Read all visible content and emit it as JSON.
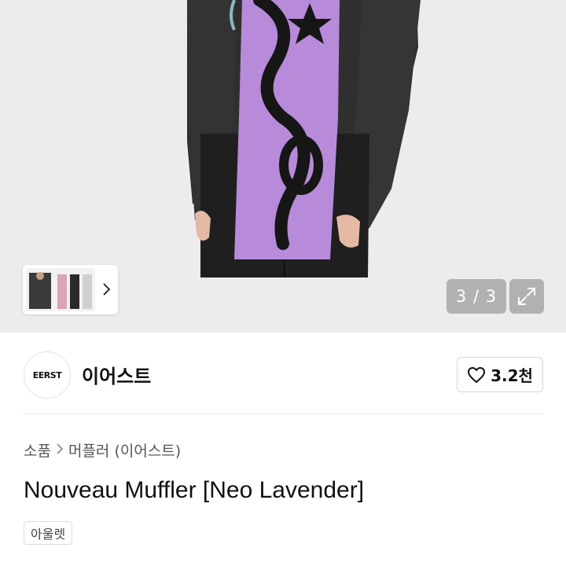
{
  "gallery": {
    "counter": "3 / 3",
    "image_count": 3,
    "current_index": 3,
    "product_colors": {
      "scarf": "#b78bd9",
      "scarf_pattern": "#161616",
      "sweater": "#2e2e2e",
      "background": "#ececec"
    }
  },
  "seller": {
    "logo_text": "EERST",
    "name": "이어스트",
    "like_count": "3.2천"
  },
  "breadcrumb": {
    "category": "소품",
    "subcategory": "머플러 (이어스트)"
  },
  "product": {
    "title": "Nouveau Muffler [Neo Lavender]",
    "tag": "아울렛"
  }
}
